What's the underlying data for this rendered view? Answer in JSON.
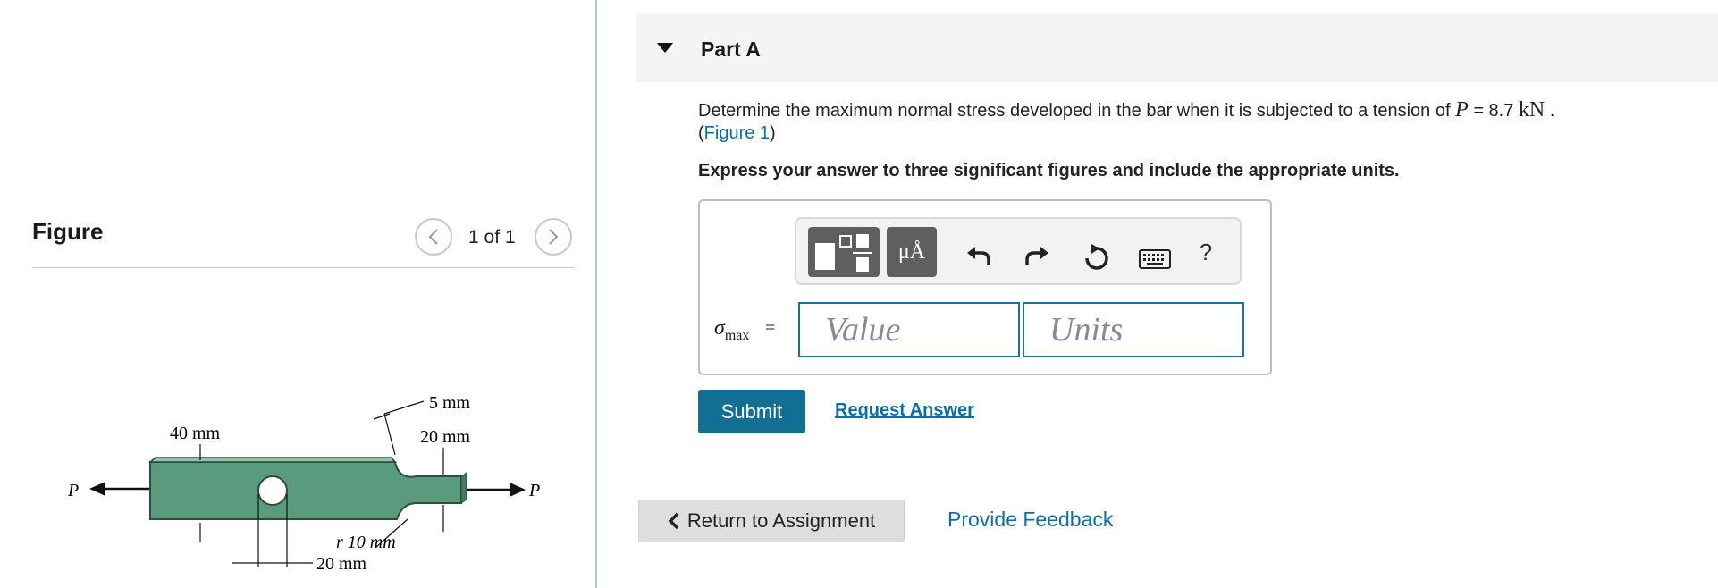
{
  "figure_pane": {
    "title": "Figure",
    "pager_text": "1 of 1",
    "prev_icon": "chevron-left-icon",
    "next_icon": "chevron-right-icon",
    "diagram": {
      "load_left": "P",
      "load_right": "P",
      "dim_width_large": "40 mm",
      "dim_fillet_offset": "5 mm",
      "dim_width_small": "20 mm",
      "dim_fillet_radius": "r  10 mm",
      "dim_hole_diameter": "20 mm",
      "bar_color": "#5a9a7f"
    }
  },
  "part": {
    "title": "Part A",
    "prompt_prefix": "Determine the maximum normal stress developed in the bar when it is subjected to a tension of ",
    "prompt_var": "P",
    "prompt_value": " = 8.7  ",
    "prompt_unit": "kN",
    "prompt_suffix": " .",
    "figure_link_open": "(",
    "figure_link": "Figure 1",
    "figure_link_close": ")",
    "instruction": "Express your answer to three significant figures and include the appropriate units."
  },
  "answer": {
    "toolbar": {
      "units_label": "μÅ",
      "help_label": "?"
    },
    "symbol": "σ",
    "symbol_sub": "max",
    "equals": "=",
    "value_placeholder": "Value",
    "units_placeholder": "Units"
  },
  "actions": {
    "submit_label": "Submit",
    "request_answer_label": "Request Answer",
    "return_label": "Return to Assignment",
    "feedback_label": "Provide Feedback"
  },
  "colors": {
    "accent": "#136e94",
    "link": "#0b6fa4",
    "input_border": "#1f6f97"
  }
}
